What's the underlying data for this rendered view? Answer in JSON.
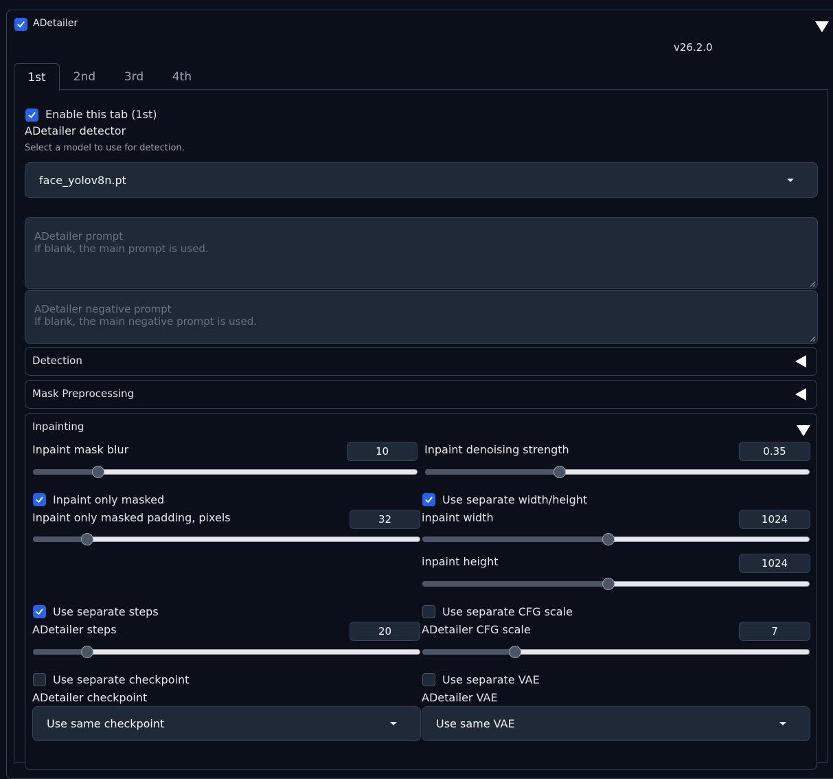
{
  "header": {
    "title": "ADetailer",
    "enabled": true,
    "version": "v26.2.0"
  },
  "tabs": [
    {
      "label": "1st",
      "active": true
    },
    {
      "label": "2nd",
      "active": false
    },
    {
      "label": "3rd",
      "active": false
    },
    {
      "label": "4th",
      "active": false
    }
  ],
  "panel": {
    "enable_tab": {
      "label": "Enable this tab (1st)",
      "checked": true
    },
    "detector": {
      "label": "ADetailer detector",
      "info": "Select a model to use for detection.",
      "value": "face_yolov8n.pt"
    },
    "prompt": {
      "placeholder_line1": "ADetailer prompt",
      "placeholder_line2": "If blank, the main prompt is used."
    },
    "negative_prompt": {
      "placeholder_line1": "ADetailer negative prompt",
      "placeholder_line2": "If blank, the main negative prompt is used."
    },
    "accordions": {
      "detection": "Detection",
      "mask_preprocessing": "Mask Preprocessing",
      "inpainting": "Inpainting"
    }
  },
  "inpainting": {
    "mask_blur": {
      "label": "Inpaint mask blur",
      "value": "10",
      "fraction": 0.17
    },
    "denoising": {
      "label": "Inpaint denoising strength",
      "value": "0.35",
      "fraction": 0.35
    },
    "only_masked": {
      "label": "Inpaint only masked",
      "checked": true
    },
    "separate_wh": {
      "label": "Use separate width/height",
      "checked": true
    },
    "masked_padding": {
      "label": "Inpaint only masked padding, pixels",
      "value": "32",
      "fraction": 0.14
    },
    "width": {
      "label": "inpaint width",
      "value": "1024",
      "fraction": 0.48
    },
    "height": {
      "label": "inpaint height",
      "value": "1024",
      "fraction": 0.48
    },
    "separate_steps": {
      "label": "Use separate steps",
      "checked": true
    },
    "separate_cfg": {
      "label": "Use separate CFG scale",
      "checked": false
    },
    "steps": {
      "label": "ADetailer steps",
      "value": "20",
      "fraction": 0.14
    },
    "cfg": {
      "label": "ADetailer CFG scale",
      "value": "7",
      "fraction": 0.24
    },
    "separate_checkpoint": {
      "label": "Use separate checkpoint",
      "checked": false
    },
    "separate_vae": {
      "label": "Use separate VAE",
      "checked": false
    },
    "checkpoint": {
      "label": "ADetailer checkpoint",
      "value": "Use same checkpoint"
    },
    "vae": {
      "label": "ADetailer VAE",
      "value": "Use same VAE"
    }
  },
  "colors": {
    "accent": "#2563eb",
    "background": "#0b0f19",
    "input_bg": "#1f2937",
    "border": "#374151"
  }
}
